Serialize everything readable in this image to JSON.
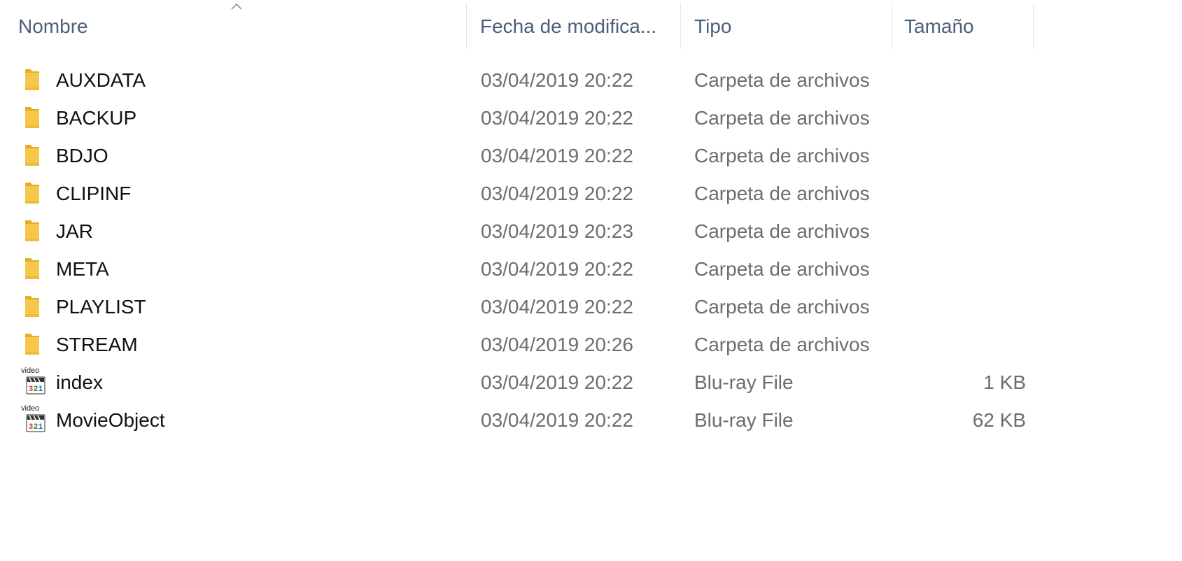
{
  "columns": {
    "name": "Nombre",
    "date": "Fecha de modifica...",
    "type": "Tipo",
    "size": "Tamaño"
  },
  "sort": {
    "column": "name",
    "direction": "ascending",
    "icon": "sort-up-caret-icon"
  },
  "colors": {
    "header_text": "#4c607a",
    "name_text": "#111111",
    "secondary_text": "#6d6d6d",
    "folder": "#f5c74a",
    "folder_dark": "#e3ad28"
  },
  "files": [
    {
      "name": "AUXDATA",
      "date": "03/04/2019 20:22",
      "type": "Carpeta de archivos",
      "size": "",
      "icon": "folder-icon"
    },
    {
      "name": "BACKUP",
      "date": "03/04/2019 20:22",
      "type": "Carpeta de archivos",
      "size": "",
      "icon": "folder-icon"
    },
    {
      "name": "BDJO",
      "date": "03/04/2019 20:22",
      "type": "Carpeta de archivos",
      "size": "",
      "icon": "folder-icon"
    },
    {
      "name": "CLIPINF",
      "date": "03/04/2019 20:22",
      "type": "Carpeta de archivos",
      "size": "",
      "icon": "folder-icon"
    },
    {
      "name": "JAR",
      "date": "03/04/2019 20:23",
      "type": "Carpeta de archivos",
      "size": "",
      "icon": "folder-icon"
    },
    {
      "name": "META",
      "date": "03/04/2019 20:22",
      "type": "Carpeta de archivos",
      "size": "",
      "icon": "folder-icon"
    },
    {
      "name": "PLAYLIST",
      "date": "03/04/2019 20:22",
      "type": "Carpeta de archivos",
      "size": "",
      "icon": "folder-icon"
    },
    {
      "name": "STREAM",
      "date": "03/04/2019 20:26",
      "type": "Carpeta de archivos",
      "size": "",
      "icon": "folder-icon"
    },
    {
      "name": "index",
      "date": "03/04/2019 20:22",
      "type": "Blu-ray File",
      "size": "1 KB",
      "icon": "video-file-icon",
      "icon_text": "video"
    },
    {
      "name": "MovieObject",
      "date": "03/04/2019 20:22",
      "type": "Blu-ray File",
      "size": "62 KB",
      "icon": "video-file-icon",
      "icon_text": "video"
    }
  ]
}
